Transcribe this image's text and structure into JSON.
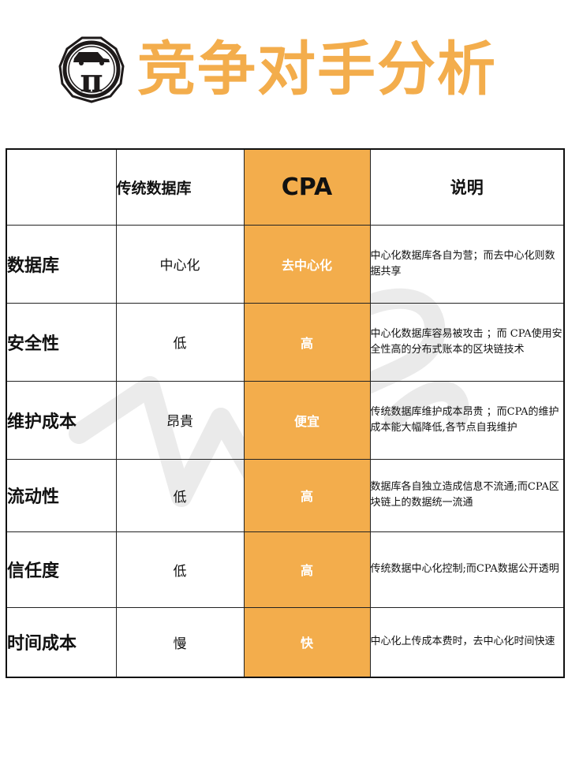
{
  "title": "竞争对手分析",
  "colors": {
    "accent": "#f3ad4c",
    "logo_dark": "#1e1a1a"
  },
  "logo": {
    "glyph": "π",
    "icon": "car-icon"
  },
  "table": {
    "headers": [
      "",
      "传统数据库",
      "CPA",
      "说明"
    ],
    "rows": [
      {
        "label": "数据库",
        "traditional": "中心化",
        "cpa": "去中心化",
        "note": "中心化数据库各自为营；而去中心化则数据共享"
      },
      {
        "label": "安全性",
        "traditional": "低",
        "cpa": "高",
        "note": "中心化数据库容易被攻击 ；而 CPA使用安全性高的分布式账本的区块链技术"
      },
      {
        "label": "维护成本",
        "traditional": "昂貴",
        "cpa": "便宜",
        "note": "传统数据库维护成本昂贵 ；而CPA的维护成本能大幅降低,各节点自我维护"
      },
      {
        "label": "流动性",
        "traditional": "低",
        "cpa": "高",
        "note": "数据库各自独立造成信息不流通;而CPA区块链上的数据统一流通"
      },
      {
        "label": "信任度",
        "traditional": "低",
        "cpa": "高",
        "note": "传统数据中心化控制;而CPA数据公开透明"
      },
      {
        "label": "时间成本",
        "traditional": "慢",
        "cpa": "快",
        "note": "中心化上传成本费时，去中心化时间快速"
      }
    ]
  }
}
